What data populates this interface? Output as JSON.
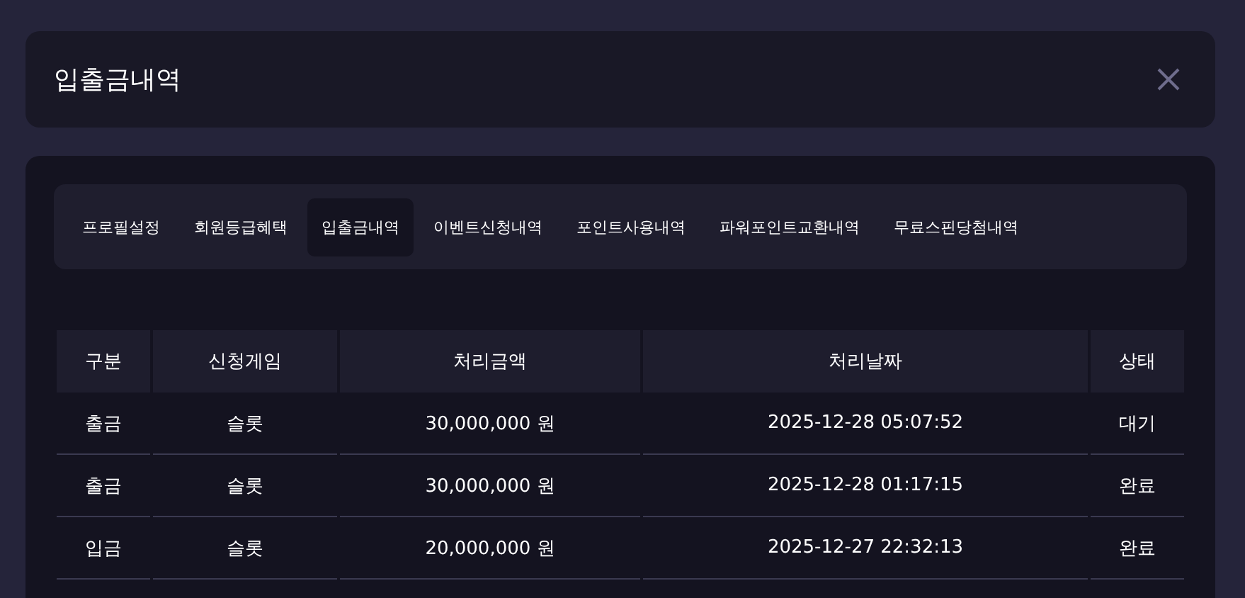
{
  "dialog": {
    "title": "입출금내역"
  },
  "tabs": [
    {
      "label": "프로필설정",
      "selected": false
    },
    {
      "label": "회원등급혜택",
      "selected": false
    },
    {
      "label": "입출금내역",
      "selected": true
    },
    {
      "label": "이벤트신청내역",
      "selected": false
    },
    {
      "label": "포인트사용내역",
      "selected": false
    },
    {
      "label": "파워포인트교환내역",
      "selected": false
    },
    {
      "label": "무료스핀당첨내역",
      "selected": false
    }
  ],
  "table": {
    "columns": [
      "구분",
      "신청게임",
      "처리금액",
      "처리날짜",
      "상태"
    ],
    "rows": [
      [
        "출금",
        "슬롯",
        "30,000,000 원",
        "2025-12-28 05:07:52",
        "대기"
      ],
      [
        "출금",
        "슬롯",
        "30,000,000 원",
        "2025-12-28 01:17:15",
        "완료"
      ],
      [
        "입금",
        "슬롯",
        "20,000,000 원",
        "2025-12-27 22:32:13",
        "완료"
      ]
    ]
  }
}
